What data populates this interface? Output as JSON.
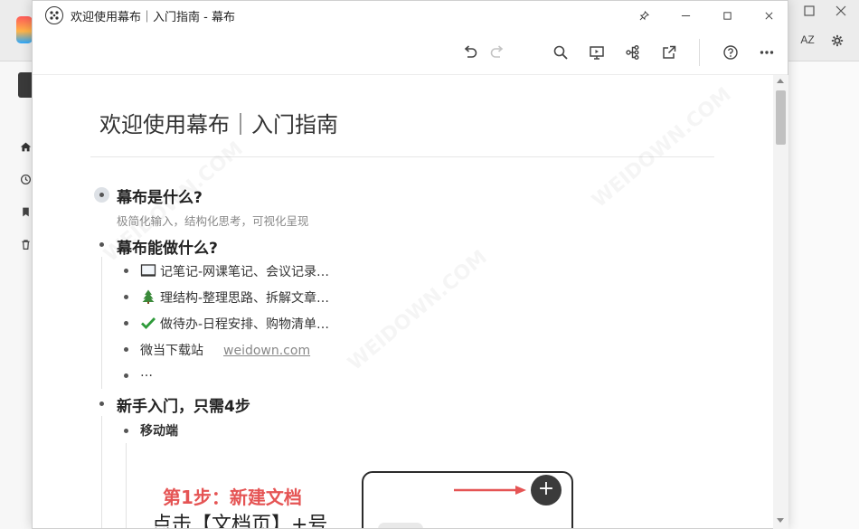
{
  "window": {
    "title": "欢迎使用幕布｜入门指南 - 幕布",
    "controls": [
      "pin-icon",
      "minimize-icon",
      "maximize-icon",
      "close-icon"
    ]
  },
  "toolbar": {
    "items": [
      "undo-icon",
      "redo-icon",
      "search-icon",
      "presentation-icon",
      "mindmap-icon",
      "share-icon",
      "help-icon",
      "more-icon"
    ]
  },
  "background_app": {
    "sidebar_icons": [
      "home-icon",
      "recent-icon",
      "bookmark-icon",
      "trash-icon"
    ],
    "top_right": {
      "sort_label": "AZ",
      "icons": [
        "window-restore-icon",
        "close-icon",
        "settings-icon"
      ]
    }
  },
  "document": {
    "title": "欢迎使用幕布｜入门指南",
    "nodes": [
      {
        "text": "幕布是什么?",
        "note": "极简化输入，结构化思考，可视化呈现",
        "collapsed": true
      },
      {
        "text": "幕布能做什么?",
        "children": [
          {
            "icon": "notebook-icon",
            "text": "记笔记-网课笔记、会议记录…"
          },
          {
            "icon": "tree-icon",
            "text": "理结构-整理思路、拆解文章…"
          },
          {
            "icon": "checkmark-icon",
            "text": "做待办-日程安排、购物清单…"
          },
          {
            "text": "微当下载站",
            "link": "weidown.com"
          },
          {
            "text": "…"
          }
        ]
      },
      {
        "text": "新手入门，只需4步",
        "children": [
          {
            "text": "移动端",
            "bold": true
          }
        ]
      }
    ],
    "image": {
      "red_heading": "第1步：新建文档",
      "black_text": "点击【文档页】+号",
      "plus_symbol": "+"
    }
  },
  "watermark": "WEIDOWN.COM",
  "colors": {
    "accent_red": "#e55454",
    "checkmark_green": "#2e9a3a",
    "tree_green": "#3a8a3a"
  }
}
